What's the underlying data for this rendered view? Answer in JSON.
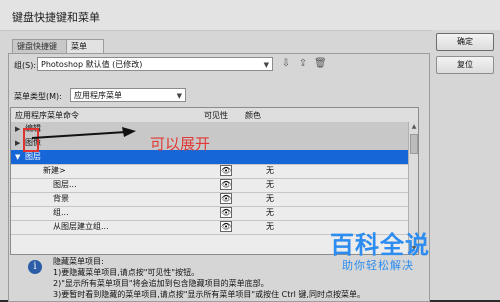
{
  "window": {
    "title": "键盘快捷键和菜单"
  },
  "buttons": {
    "ok": "确定",
    "reset": "复位"
  },
  "tabs": [
    "键盘快捷键",
    "菜单"
  ],
  "set": {
    "label": "组(S):",
    "value": "Photoshop 默认值 (已修改)"
  },
  "menu_type": {
    "label": "菜单类型(M):",
    "value": "应用程序菜单"
  },
  "table": {
    "headers": {
      "command": "应用程序菜单命令",
      "visibility": "可见性",
      "color": "颜色"
    },
    "rows": [
      {
        "label": "编辑",
        "kind": "group",
        "expanded": false
      },
      {
        "label": "图像",
        "kind": "group",
        "expanded": false
      },
      {
        "label": "图层",
        "kind": "selected",
        "expanded": true
      },
      {
        "label": "新建>",
        "kind": "item",
        "color": "无"
      },
      {
        "label": "图层...",
        "kind": "item",
        "color": "无"
      },
      {
        "label": "背景",
        "kind": "item",
        "color": "无"
      },
      {
        "label": "组...",
        "kind": "item",
        "color": "无"
      },
      {
        "label": "从图层建立组...",
        "kind": "item",
        "color": "无"
      }
    ]
  },
  "annotation": {
    "text": "可以展开"
  },
  "info": {
    "lines": [
      "隐藏菜单项目:",
      "1)要隐藏菜单项目,请点按\"可见性\"按钮。",
      "2)\"显示所有菜单项目\"将会追加到包含隐藏项目的菜单底部。",
      "3)要暂时看到隐藏的菜单项目,请点按\"显示所有菜单项目\"或按住 Ctrl 键,同时点按菜单。"
    ]
  },
  "watermark": {
    "title": "百科全说",
    "subtitle": "助你轻松解决"
  },
  "colors": {
    "selected_row": "#1766d8",
    "annotation": "#e13a36",
    "watermark": "#2d8cf0"
  }
}
